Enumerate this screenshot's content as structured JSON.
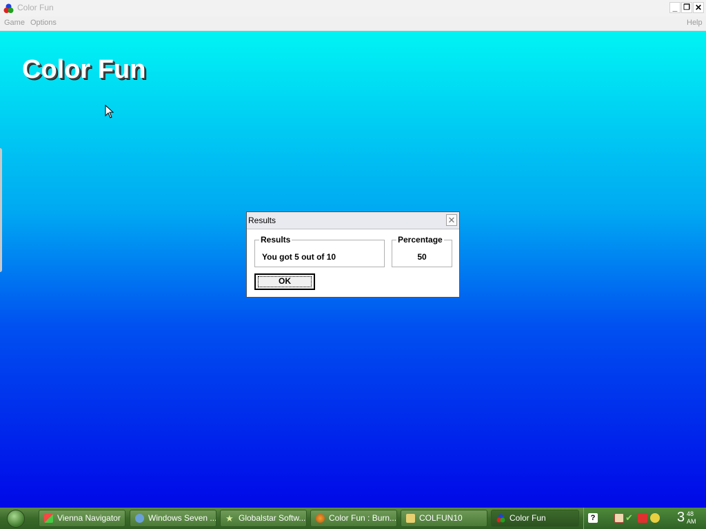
{
  "window": {
    "title": "Color Fun",
    "minimize_glyph": "_",
    "restore_glyph": "❐",
    "close_glyph": "✕"
  },
  "menubar": {
    "items": [
      "Game",
      "Options"
    ],
    "help": "Help"
  },
  "main": {
    "title": "Color Fun",
    "background_colors": [
      "#00f4f4",
      "#0008e8"
    ]
  },
  "dialog": {
    "title": "Results",
    "close_glyph": "✕",
    "results_group": {
      "label": "Results",
      "value": "You got 5 out of 10"
    },
    "percentage_group": {
      "label": "Percentage",
      "value": "50"
    },
    "ok_label": "OK"
  },
  "taskbar": {
    "tasks": [
      {
        "label": "Vienna Navigator",
        "icon": "vienna-icon"
      },
      {
        "label": "Windows Seven ...",
        "icon": "globe-icon"
      },
      {
        "label": "Globalstar Softw...",
        "icon": "star-icon"
      },
      {
        "label": "Color Fun : Burn...",
        "icon": "firefox-icon"
      },
      {
        "label": "COLFUN10",
        "icon": "folder-icon"
      },
      {
        "label": "Color Fun",
        "icon": "color-fun-icon"
      }
    ],
    "tray_icons": [
      "help-icon",
      "shield-icon",
      "check-icon",
      "network-icon",
      "clock-icon"
    ],
    "clock": {
      "hour": "3",
      "minute": "48",
      "ampm": "AM"
    }
  }
}
